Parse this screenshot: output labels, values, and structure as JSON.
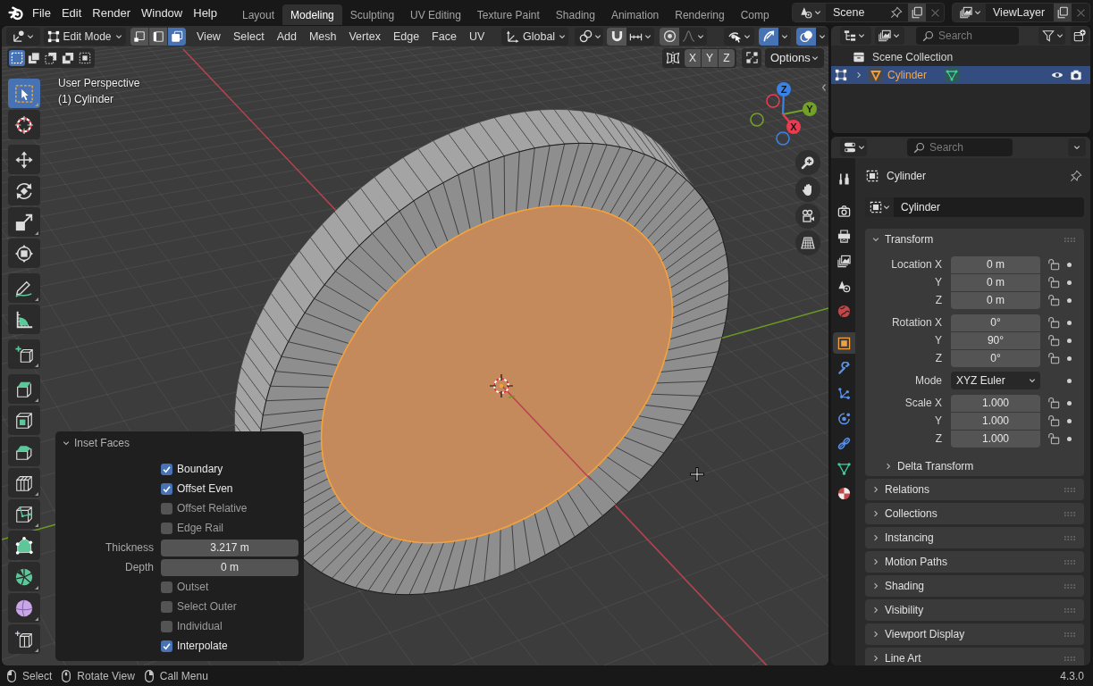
{
  "top_bar": {
    "menus": [
      "File",
      "Edit",
      "Render",
      "Window",
      "Help"
    ],
    "workspaces": [
      {
        "label": "Layout",
        "selected": false
      },
      {
        "label": "Modeling",
        "selected": true
      },
      {
        "label": "Sculpting",
        "selected": false
      },
      {
        "label": "UV Editing",
        "selected": false
      },
      {
        "label": "Texture Paint",
        "selected": false
      },
      {
        "label": "Shading",
        "selected": false
      },
      {
        "label": "Animation",
        "selected": false
      },
      {
        "label": "Rendering",
        "selected": false
      },
      {
        "label": "Comp",
        "selected": false
      }
    ],
    "scene": "Scene",
    "view_layer": "ViewLayer"
  },
  "viewport": {
    "header": {
      "mode": "Edit Mode",
      "select_modes": [
        {
          "kind": "vertex",
          "selected": false
        },
        {
          "kind": "edge",
          "selected": false
        },
        {
          "kind": "face",
          "selected": true
        }
      ],
      "menus": [
        "View",
        "Select",
        "Add",
        "Mesh",
        "Vertex",
        "Edge",
        "Face",
        "UV"
      ],
      "orientation": "Global",
      "toggles": [
        {
          "kind": "snap",
          "on": false
        },
        {
          "kind": "proportional",
          "on": false
        },
        {
          "kind": "gizmos",
          "on": true
        },
        {
          "kind": "overlays",
          "on": true
        }
      ]
    },
    "tool_header": {
      "selection_modes": [
        {
          "kind": "set",
          "selected": true
        },
        {
          "kind": "extend",
          "selected": false
        },
        {
          "kind": "subtract",
          "selected": false
        },
        {
          "kind": "difference",
          "selected": false
        },
        {
          "kind": "intersect",
          "selected": false
        }
      ],
      "mirror_axes": [
        {
          "label": "X",
          "on": false
        },
        {
          "label": "Y",
          "on": false
        },
        {
          "label": "Z",
          "on": false
        }
      ],
      "options": "Options"
    },
    "info": [
      "User Perspective",
      "(1) Cylinder"
    ],
    "tool_groups": [
      {
        "tools": [
          {
            "kind": "select-box",
            "selected": true,
            "submenu": true
          },
          {
            "kind": "cursor",
            "selected": false,
            "submenu": false
          }
        ]
      },
      {
        "tools": [
          {
            "kind": "move",
            "selected": false,
            "submenu": false
          },
          {
            "kind": "rotate",
            "selected": false,
            "submenu": false
          },
          {
            "kind": "scale",
            "selected": false,
            "submenu": true
          },
          {
            "kind": "transform",
            "selected": false,
            "submenu": false
          }
        ]
      },
      {
        "tools": [
          {
            "kind": "annotate",
            "selected": false,
            "submenu": true
          },
          {
            "kind": "measure",
            "selected": false,
            "submenu": false
          }
        ]
      },
      {
        "tools": [
          {
            "kind": "add-cube",
            "selected": false,
            "submenu": true
          }
        ]
      },
      {
        "tools": [
          {
            "kind": "extrude",
            "selected": false,
            "submenu": true
          },
          {
            "kind": "inset",
            "selected": false,
            "submenu": false
          },
          {
            "kind": "bevel",
            "selected": false,
            "submenu": false
          },
          {
            "kind": "loop-cut",
            "selected": false,
            "submenu": true
          },
          {
            "kind": "knife",
            "selected": false,
            "submenu": true
          },
          {
            "kind": "poly-build",
            "selected": false,
            "submenu": false
          },
          {
            "kind": "spin",
            "selected": false,
            "submenu": true
          },
          {
            "kind": "smooth",
            "selected": false,
            "submenu": true
          },
          {
            "kind": "edge-slide",
            "selected": false,
            "submenu": true
          }
        ]
      }
    ],
    "gizmo": {
      "axes": [
        {
          "label": "Z",
          "color": "#3b82e6"
        },
        {
          "label": "Y",
          "color": "#73a125"
        },
        {
          "label": "X",
          "color": "#ee3a50"
        }
      ]
    }
  },
  "operator_panel": {
    "title": "Inset Faces",
    "expanded": true,
    "rows": [
      {
        "kind": "checkbox",
        "label": "Boundary",
        "checked": true
      },
      {
        "kind": "checkbox",
        "label": "Offset Even",
        "checked": true
      },
      {
        "kind": "checkbox",
        "label": "Offset Relative",
        "checked": false
      },
      {
        "kind": "checkbox",
        "label": "Edge Rail",
        "checked": false
      },
      {
        "kind": "number",
        "label": "Thickness",
        "value": "3.217 m"
      },
      {
        "kind": "number",
        "label": "Depth",
        "value": "0 m"
      },
      {
        "kind": "checkbox",
        "label": "Outset",
        "checked": false
      },
      {
        "kind": "checkbox",
        "label": "Select Outer",
        "checked": false
      },
      {
        "kind": "checkbox",
        "label": "Individual",
        "checked": false
      },
      {
        "kind": "checkbox",
        "label": "Interpolate",
        "checked": true
      }
    ]
  },
  "outliner": {
    "search": {
      "placeholder": "Search"
    },
    "rows": [
      {
        "kind": "collection",
        "label": "Scene Collection",
        "selected": false,
        "active": false
      },
      {
        "kind": "object",
        "label": "Cylinder",
        "selected": true,
        "active": true,
        "expanded": false,
        "visible": true,
        "renderable": true
      }
    ]
  },
  "properties": {
    "search": {
      "placeholder": "Search"
    },
    "tab_groups": [
      {
        "tabs": [
          {
            "kind": "tool",
            "selected": false
          }
        ]
      },
      {
        "tabs": [
          {
            "kind": "render",
            "selected": false
          },
          {
            "kind": "output",
            "selected": false
          },
          {
            "kind": "view-layer",
            "selected": false
          },
          {
            "kind": "scene",
            "selected": false
          },
          {
            "kind": "world",
            "selected": false
          }
        ]
      },
      {
        "tabs": [
          {
            "kind": "object",
            "selected": true
          },
          {
            "kind": "modifiers",
            "selected": false
          },
          {
            "kind": "particles",
            "selected": false
          },
          {
            "kind": "physics",
            "selected": false
          },
          {
            "kind": "constraints",
            "selected": false
          },
          {
            "kind": "data",
            "selected": false
          },
          {
            "kind": "material",
            "selected": false
          }
        ]
      }
    ],
    "context": "Cylinder",
    "object_name": "Cylinder",
    "panels": [
      {
        "title": "Transform",
        "expanded": true,
        "groups": [
          {
            "kind": "vector",
            "rows": [
              {
                "label": "Location X",
                "value": "0 m",
                "locked": false
              },
              {
                "label": "Y",
                "value": "0 m",
                "locked": false
              },
              {
                "label": "Z",
                "value": "0 m",
                "locked": false
              }
            ]
          },
          {
            "kind": "vector",
            "rows": [
              {
                "label": "Rotation X",
                "value": "0°",
                "locked": false
              },
              {
                "label": "Y",
                "value": "90°",
                "locked": false
              },
              {
                "label": "Z",
                "value": "0°",
                "locked": false
              }
            ]
          },
          {
            "kind": "dropdown",
            "rows": [
              {
                "label": "Mode",
                "value": "XYZ Euler"
              }
            ]
          },
          {
            "kind": "vector",
            "rows": [
              {
                "label": "Scale X",
                "value": "1.000",
                "locked": false
              },
              {
                "label": "Y",
                "value": "1.000",
                "locked": false
              },
              {
                "label": "Z",
                "value": "1.000",
                "locked": false
              }
            ]
          }
        ],
        "subpanels": [
          {
            "title": "Delta Transform",
            "expanded": false
          }
        ]
      },
      {
        "title": "Relations",
        "expanded": false
      },
      {
        "title": "Collections",
        "expanded": false
      },
      {
        "title": "Instancing",
        "expanded": false
      },
      {
        "title": "Motion Paths",
        "expanded": false
      },
      {
        "title": "Shading",
        "expanded": false
      },
      {
        "title": "Visibility",
        "expanded": false
      },
      {
        "title": "Viewport Display",
        "expanded": false
      },
      {
        "title": "Line Art",
        "expanded": false
      }
    ]
  },
  "status_bar": {
    "hints": [
      {
        "kind": "left-click",
        "label": "Select"
      },
      {
        "kind": "middle-click",
        "label": "Rotate View"
      },
      {
        "kind": "right-click",
        "label": "Call Menu"
      }
    ],
    "version": "4.3.0"
  }
}
